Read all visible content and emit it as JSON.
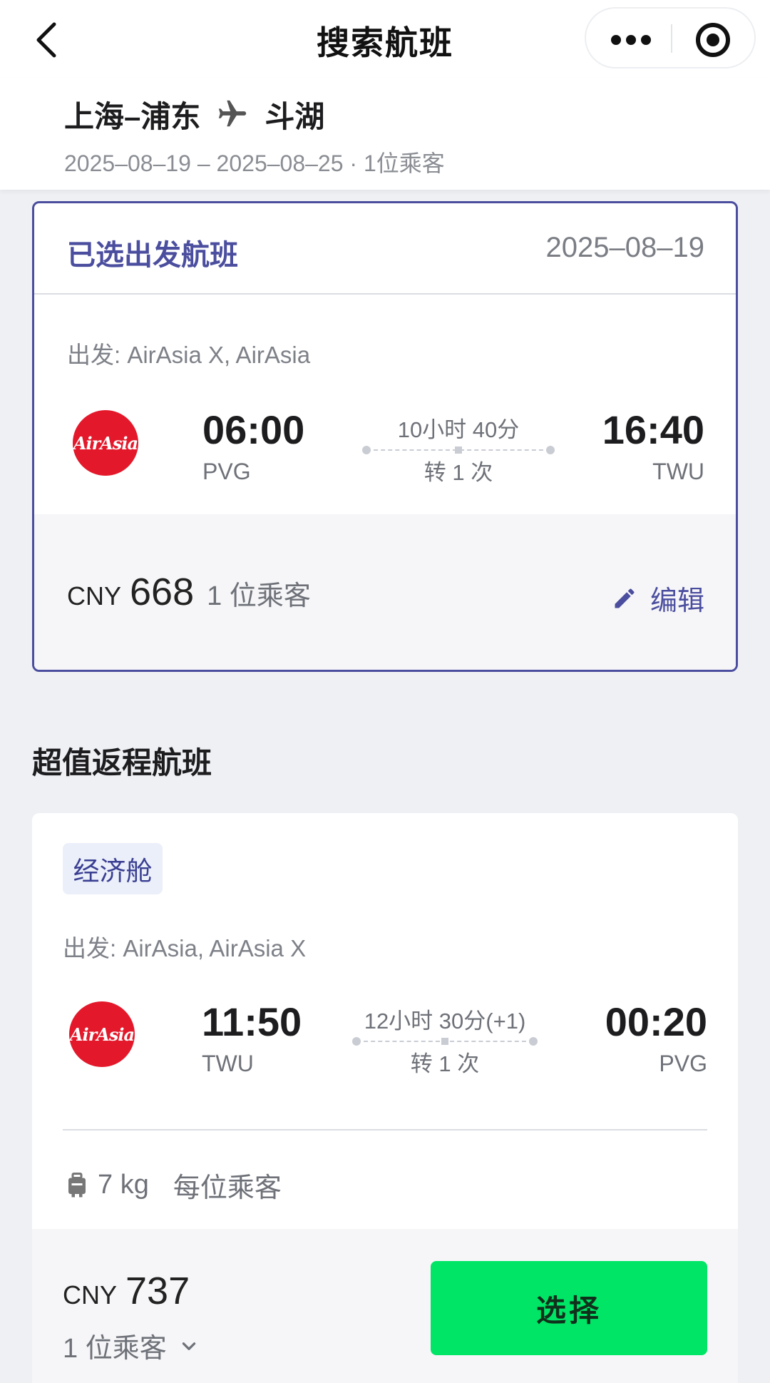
{
  "nav": {
    "title": "搜索航班"
  },
  "route": {
    "origin": "上海–浦东",
    "destination": "斗湖",
    "subtitle": "2025–08–19 – 2025–08–25 · 1位乘客"
  },
  "selected": {
    "label": "已选出发航班",
    "date": "2025–08–19",
    "carriers": "出发: AirAsia X, AirAsia",
    "logo_text": "AirAsia",
    "depart_time": "06:00",
    "depart_code": "PVG",
    "duration": "10小时 40分",
    "stops": "转 1 次",
    "arrive_time": "16:40",
    "arrive_code": "TWU",
    "currency": "CNY",
    "price": "668",
    "passengers": "1 位乘客",
    "edit_label": "编辑"
  },
  "return_section": {
    "title": "超值返程航班"
  },
  "return_flight": {
    "cabin": "经济舱",
    "carriers": "出发: AirAsia, AirAsia X",
    "logo_text": "AirAsia",
    "depart_time": "11:50",
    "depart_code": "TWU",
    "duration": "12小时 30分(+1)",
    "stops": "转 1 次",
    "arrive_time": "00:20",
    "arrive_code": "PVG",
    "baggage_weight": "7 kg",
    "baggage_note": "每位乘客",
    "currency": "CNY",
    "price": "737",
    "passengers": "1 位乘客",
    "select_label": "选择"
  },
  "colors": {
    "accent": "#4b4e9e",
    "select_button": "#00e566",
    "airasia_red": "#e3192b"
  },
  "icons": [
    "back-arrow-icon",
    "more-dots-icon",
    "target-icon",
    "plane-icon",
    "pencil-icon",
    "luggage-icon",
    "chevron-down-icon"
  ]
}
